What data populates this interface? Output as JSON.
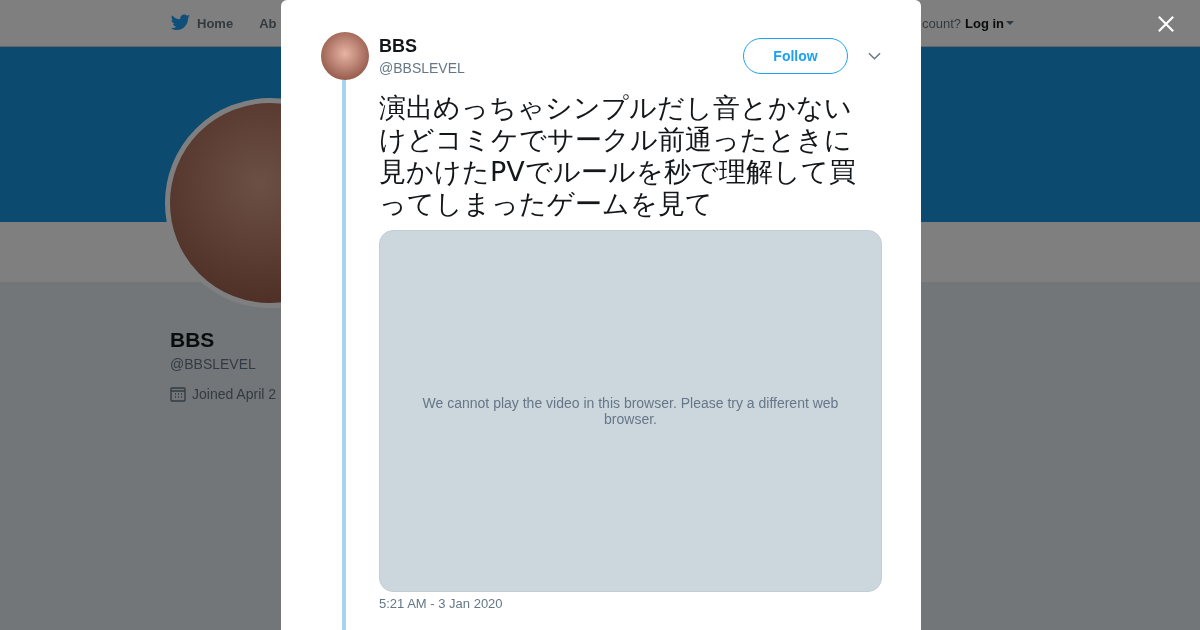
{
  "background_page": {
    "nav": {
      "home": "Home",
      "about": "Ab",
      "account_prompt": "count?",
      "login": "Log in"
    },
    "profile": {
      "name": "BBS",
      "handle": "@BBSLEVEL",
      "joined": "Joined April 2"
    }
  },
  "tweet": {
    "name": "BBS",
    "handle": "@BBSLEVEL",
    "follow": "Follow",
    "text": "演出めっちゃシンプルだし音とかないけどコミケでサークル前通ったときに見かけたPVでルールを秒で理解して買ってしまったゲームを見て",
    "video_message": "We cannot play the video in this browser. Please try a different web browser.",
    "timestamp": "5:21 AM - 3 Jan 2020"
  }
}
